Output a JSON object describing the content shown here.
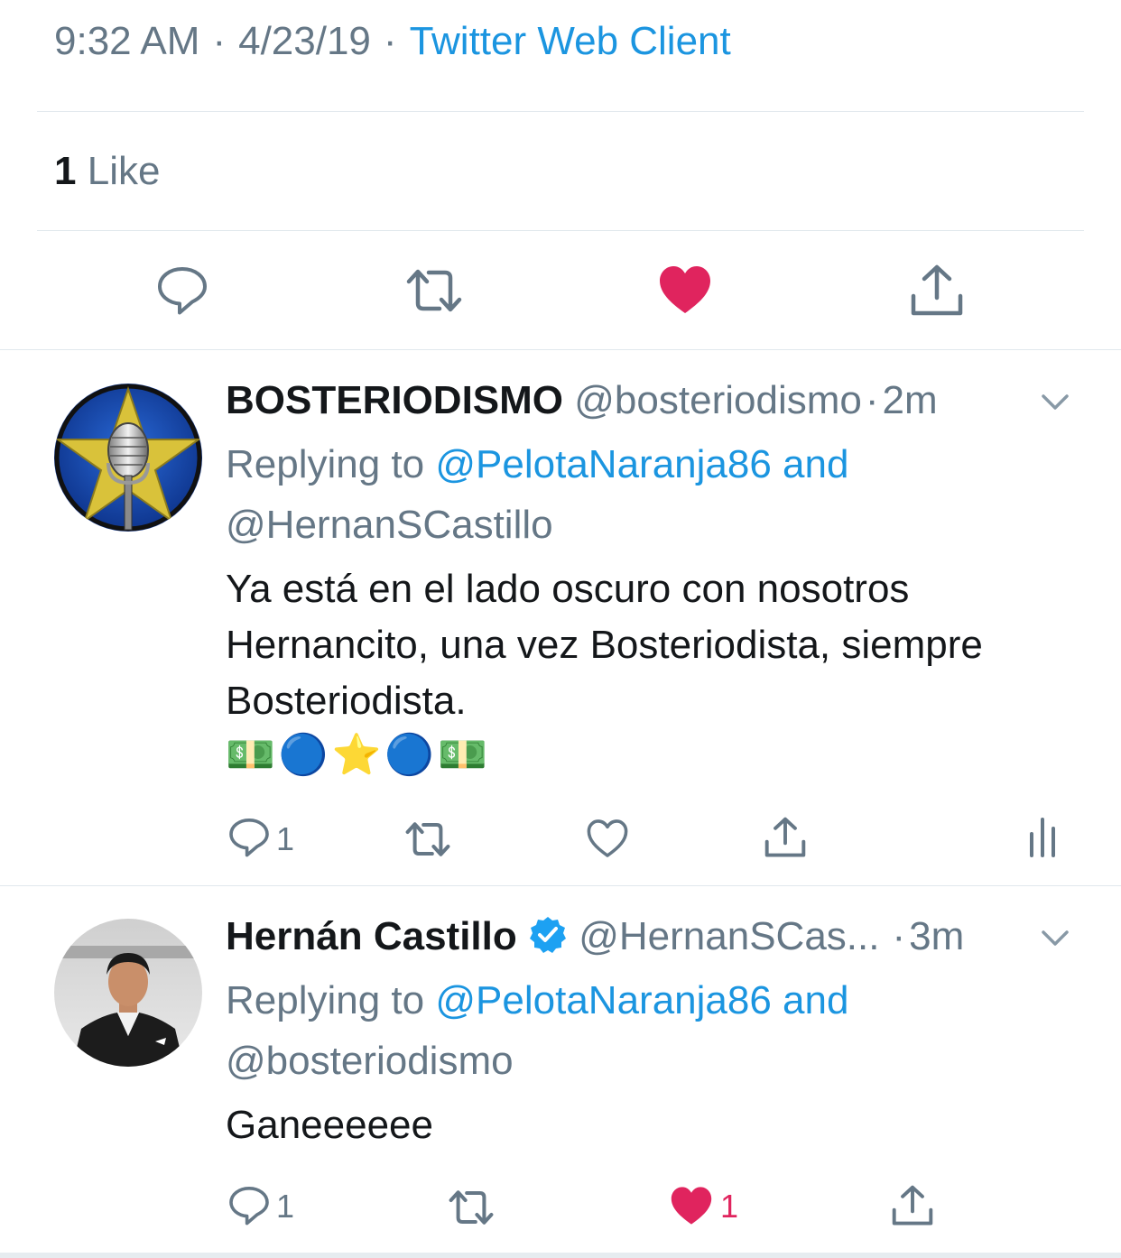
{
  "main_tweet": {
    "time": "9:32 AM",
    "date": "4/23/19",
    "source": "Twitter Web Client",
    "likes_count": "1",
    "likes_label": "Like"
  },
  "replies": [
    {
      "display_name": "BOSTERIODISMO",
      "handle": "@bosteriodismo",
      "time": "2m",
      "replying_prefix": "Replying to",
      "replying_to_1": "@PelotaNaranja86 and",
      "replying_to_2": "@HernanSCastillo",
      "text_lines": [
        "Ya está en el lado oscuro con nosotros",
        "Hernancito, una vez Bosteriodista, siempre",
        "Bosteriodista."
      ],
      "emoji": "💵🔵⭐🔵💵",
      "reply_count": "1"
    },
    {
      "display_name": "Hernán Castillo",
      "handle": "@HernanSCas...",
      "time": "3m",
      "replying_prefix": "Replying to",
      "replying_to_1": "@PelotaNaranja86 and",
      "replying_to_2": "@bosteriodismo",
      "text_lines": [
        "Ganeeeeee"
      ],
      "reply_count": "1",
      "like_count": "1"
    }
  ],
  "colors": {
    "link": "#1b95e0",
    "secondary": "#657786",
    "like": "#e0245e",
    "divider": "#e1e8ed"
  }
}
